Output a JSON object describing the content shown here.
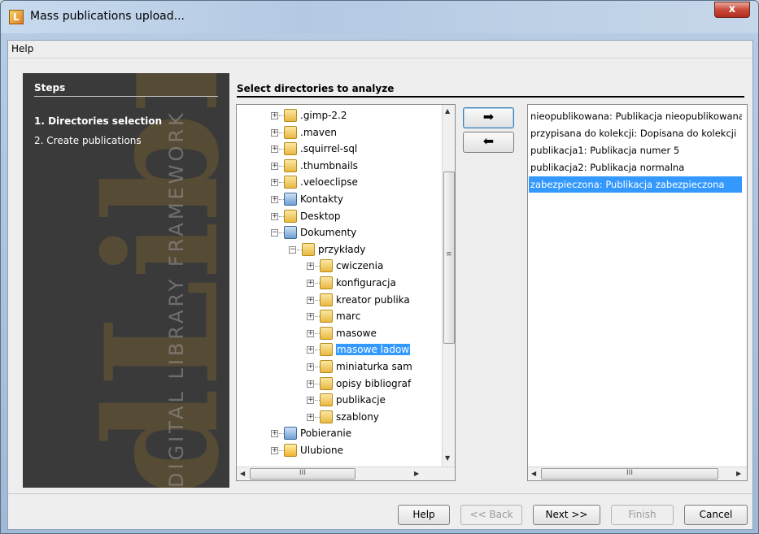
{
  "window": {
    "title": "Mass publications upload...",
    "close_glyph": "x",
    "app_icon_glyph": "L"
  },
  "menubar": {
    "items": [
      "Help"
    ]
  },
  "steps": {
    "title": "Steps",
    "items": [
      {
        "label": "1.  Directories selection",
        "active": true
      },
      {
        "label": "2.  Create publications",
        "active": false
      }
    ],
    "logo_text": "dLibra",
    "vertical_text": "DIGITAL LIBRARY FRAMEWORK"
  },
  "main": {
    "title": "Select directories to analyze"
  },
  "tree": {
    "items": [
      {
        "label": ".gimp-2.2",
        "icon": "folder-icon"
      },
      {
        "label": ".maven",
        "icon": "folder-icon"
      },
      {
        "label": ".squirrel-sql",
        "icon": "folder-icon"
      },
      {
        "label": ".thumbnails",
        "icon": "folder-icon"
      },
      {
        "label": ".veloeclipse",
        "icon": "folder-icon"
      },
      {
        "label": "Kontakty",
        "icon": "contacts-folder-icon"
      },
      {
        "label": "Desktop",
        "icon": "folder-icon"
      },
      {
        "label": "Dokumenty",
        "icon": "documents-folder-icon"
      },
      {
        "label": "przykłady",
        "icon": "folder-icon"
      },
      {
        "label": "cwiczenia",
        "icon": "folder-icon"
      },
      {
        "label": "konfiguracja",
        "icon": "folder-icon"
      },
      {
        "label": "kreator publika",
        "icon": "folder-icon"
      },
      {
        "label": "marc",
        "icon": "folder-icon"
      },
      {
        "label": "masowe",
        "icon": "folder-icon"
      },
      {
        "label": "masowe ladow",
        "icon": "folder-icon"
      },
      {
        "label": "miniaturka sam",
        "icon": "folder-icon"
      },
      {
        "label": "opisy bibliograf",
        "icon": "folder-icon"
      },
      {
        "label": "publikacje",
        "icon": "folder-icon"
      },
      {
        "label": "szablony",
        "icon": "folder-icon"
      },
      {
        "label": "Pobieranie",
        "icon": "downloads-folder-icon"
      },
      {
        "label": "Ulubione",
        "icon": "favorites-folder-icon"
      }
    ],
    "scroll_glyphs": {
      "up": "▲",
      "down": "▼",
      "left": "◀",
      "right": "▶",
      "grip_v": "≡",
      "grip_h": "III"
    }
  },
  "move_buttons": {
    "add_glyph": "➡",
    "remove_glyph": "⬅"
  },
  "selected_list": {
    "items": [
      "nieopublikowana: Publikacja nieopublikowana",
      "przypisana do kolekcji: Dopisana do kolekcji",
      "publikacja1: Publikacja numer 5",
      "publikacja2: Publikacja normalna",
      "zabezpieczona: Publikacja zabezpieczona"
    ],
    "scroll_glyphs": {
      "left": "◀",
      "right": "▶",
      "grip_h": "III"
    }
  },
  "footer": {
    "help": "Help",
    "back": "<< Back",
    "next": "Next >>",
    "finish": "Finish",
    "cancel": "Cancel"
  },
  "colors": {
    "selection": "#3399ff",
    "steps_panel_bg": "#3a3a3a"
  }
}
